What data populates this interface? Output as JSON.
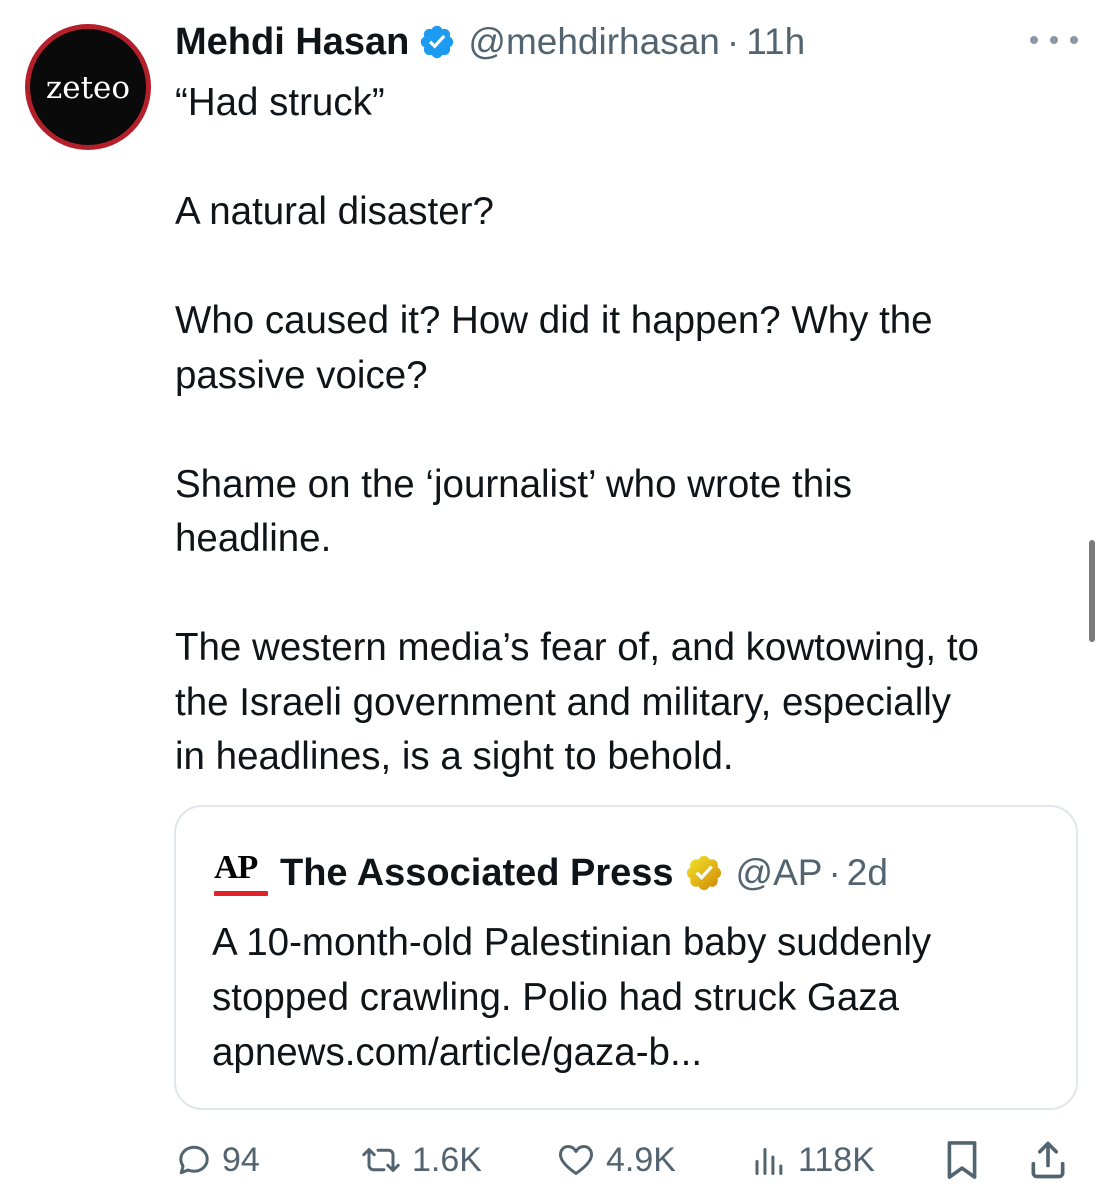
{
  "tweet": {
    "avatar_text": "zeteo",
    "author_name": "Mehdi Hasan",
    "verified_color": "#1d9bf0",
    "handle": "@mehdirhasan",
    "separator": "·",
    "time": "11h",
    "more_icon": "more-horizontal-icon",
    "text_lines": {
      "l1": "“Had struck”",
      "l2": "A natural disaster?",
      "l3": "Who caused it? How did it happen? Why the",
      "l4": "passive voice?",
      "l5": "Shame on the ‘journalist’ who wrote this",
      "l6": "headline.",
      "l7": "The western media’s fear of, and kowtowing, to",
      "l8": "the Israeli government and military, especially",
      "l9": "in headlines, is a sight to behold."
    }
  },
  "quote": {
    "logo_text": "AP",
    "logo_bar_color": "#e0222b",
    "name": "The Associated Press",
    "verified_color": "#e2b719",
    "handle": "@AP",
    "separator": "·",
    "time": "2d",
    "text_lines": {
      "l1": "A 10-month-old Palestinian baby suddenly",
      "l2": "stopped crawling. Polio had struck Gaza",
      "l3": "apnews.com/article/gaza-b..."
    }
  },
  "actions": {
    "replies": {
      "icon": "reply-icon",
      "count": "94"
    },
    "reposts": {
      "icon": "repost-icon",
      "count": "1.6K"
    },
    "likes": {
      "icon": "heart-icon",
      "count": "4.9K"
    },
    "views": {
      "icon": "views-icon",
      "count": "118K"
    },
    "bookmark": {
      "icon": "bookmark-icon"
    },
    "share": {
      "icon": "share-icon"
    }
  },
  "colors": {
    "text": "#0f1419",
    "secondary": "#536471",
    "border": "#e1e6ea",
    "avatar_ring": "#b3202a"
  }
}
